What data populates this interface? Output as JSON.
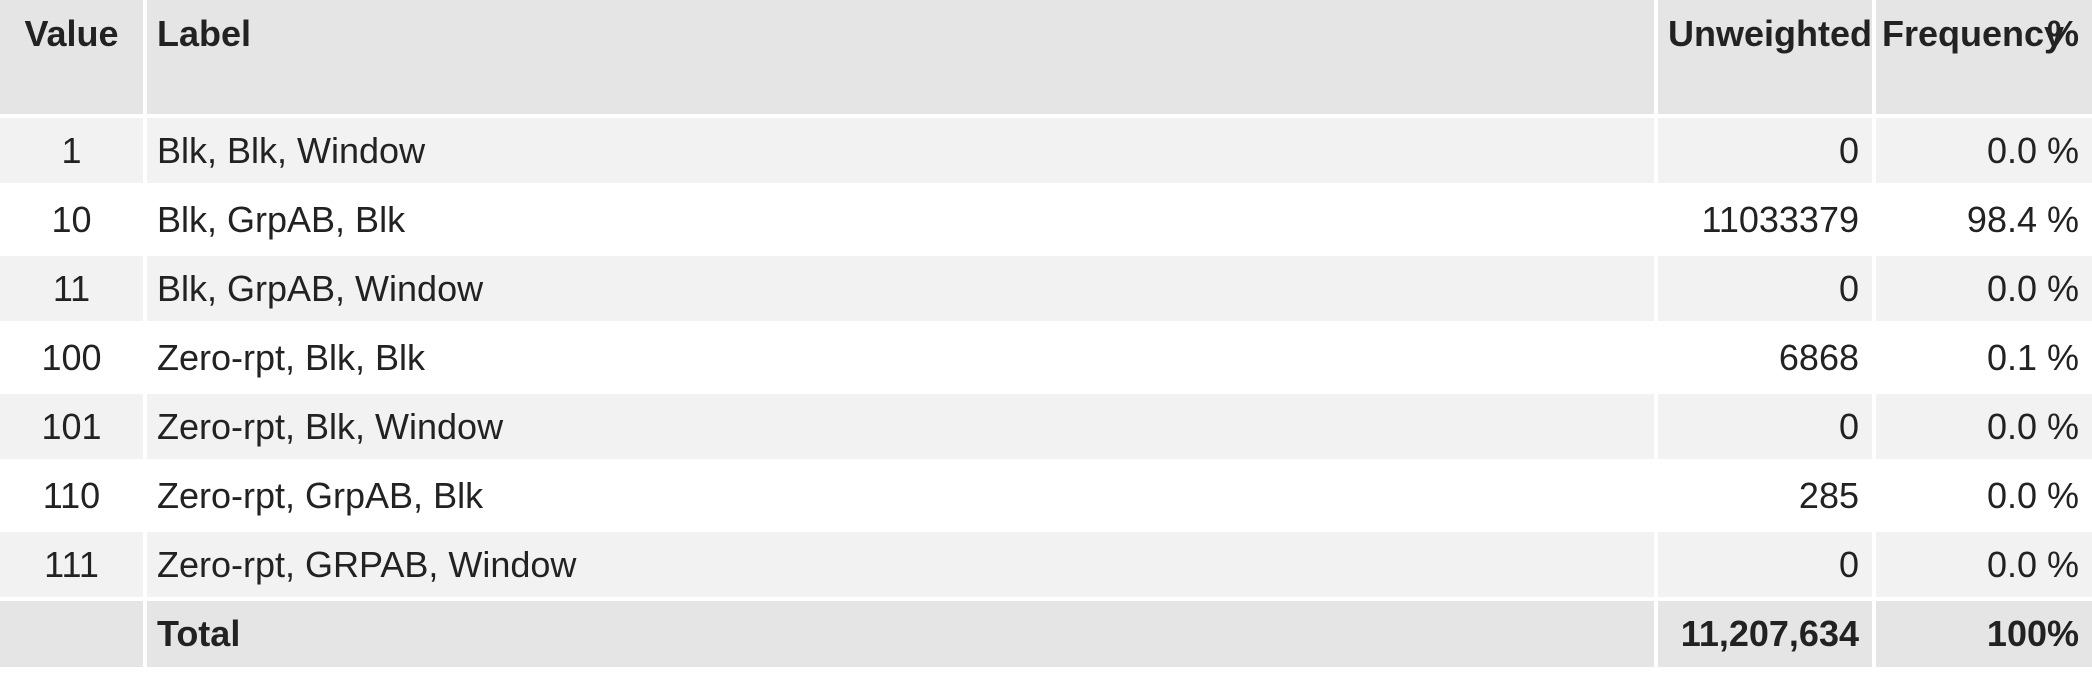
{
  "headers": {
    "value": "Value",
    "label": "Label",
    "frequency": "Unweighted Frequency",
    "percent": "%"
  },
  "rows": [
    {
      "value": "1",
      "label": "Blk, Blk, Window",
      "frequency": "0",
      "percent": "0.0 %"
    },
    {
      "value": "10",
      "label": "Blk, GrpAB, Blk",
      "frequency": "11033379",
      "percent": "98.4 %"
    },
    {
      "value": "11",
      "label": "Blk, GrpAB, Window",
      "frequency": "0",
      "percent": "0.0 %"
    },
    {
      "value": "100",
      "label": "Zero-rpt, Blk, Blk",
      "frequency": "6868",
      "percent": "0.1 %"
    },
    {
      "value": "101",
      "label": "Zero-rpt, Blk, Window",
      "frequency": "0",
      "percent": "0.0 %"
    },
    {
      "value": "110",
      "label": "Zero-rpt, GrpAB, Blk",
      "frequency": "285",
      "percent": "0.0 %"
    },
    {
      "value": "111",
      "label": "Zero-rpt, GRPAB, Window",
      "frequency": "0",
      "percent": "0.0 %"
    }
  ],
  "total": {
    "value": "",
    "label": "Total",
    "frequency": "11,207,634",
    "percent": "100%"
  }
}
